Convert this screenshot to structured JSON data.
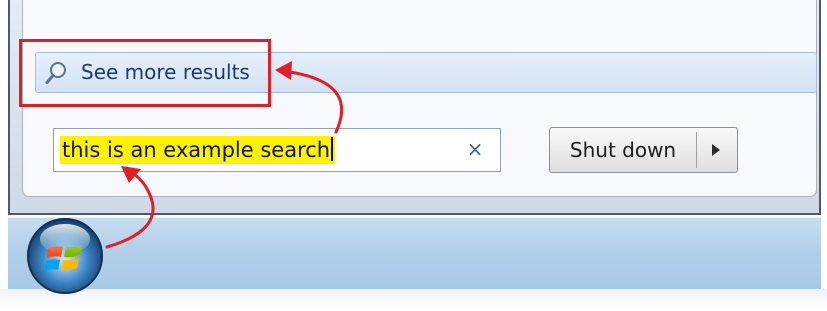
{
  "start_menu": {
    "see_more_results": {
      "label": "See more results"
    },
    "search": {
      "value": "this is an example search",
      "clear_glyph": "×"
    },
    "shutdown": {
      "label": "Shut down"
    }
  },
  "icons": {
    "search": "magnifier-icon",
    "clear": "close-icon",
    "shutdown_options": "triangle-right-icon",
    "start": "windows-start-orb-icon"
  },
  "colors": {
    "annotation": "#e31e24",
    "search_highlight": "#fff200",
    "see_more_link": "#1e3a66"
  }
}
